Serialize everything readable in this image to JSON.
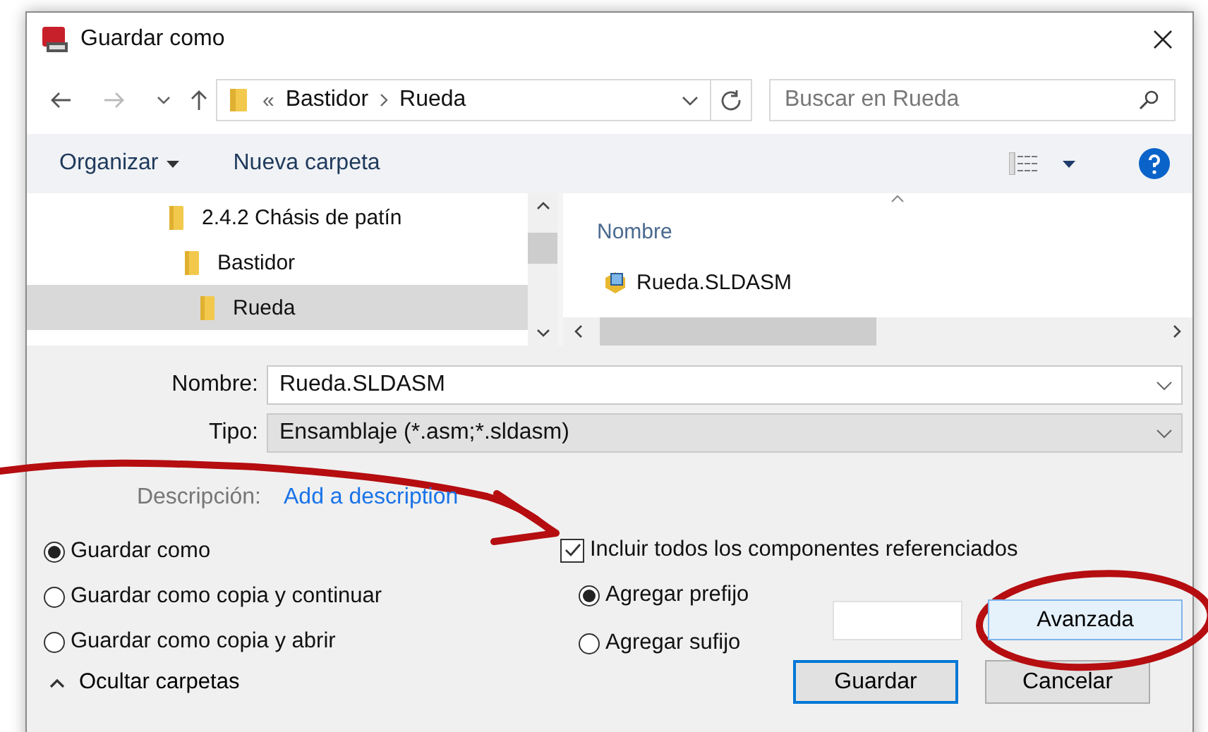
{
  "window": {
    "title": "Guardar como"
  },
  "nav": {
    "overflow": "«",
    "path": [
      {
        "label": "Bastidor"
      },
      {
        "label": "Rueda"
      }
    ],
    "search": {
      "placeholder": "Buscar en Rueda"
    }
  },
  "toolbar": {
    "organize": "Organizar",
    "new_folder": "Nueva carpeta"
  },
  "tree": [
    {
      "label": "2.4.2 Chásis de patín",
      "selected": false,
      "children": [
        {
          "label": "Bastidor",
          "selected": false,
          "children": [
            {
              "label": "Rueda",
              "selected": true
            }
          ]
        }
      ]
    }
  ],
  "files": {
    "column": "Nombre",
    "items": [
      {
        "name": "Rueda.SLDASM"
      }
    ]
  },
  "form": {
    "name_label": "Nombre:",
    "name_value": "Rueda.SLDASM",
    "type_label": "Tipo:",
    "type_value": "Ensamblaje (*.asm;*.sldasm)",
    "description_label": "Descripción:",
    "description_link": "Add a description"
  },
  "save_options": [
    {
      "label": "Guardar como",
      "selected": true
    },
    {
      "label": "Guardar como copia y continuar",
      "selected": false
    },
    {
      "label": "Guardar como copia y abrir",
      "selected": false
    }
  ],
  "include_refs": {
    "label": "Incluir todos los componentes referenciados",
    "checked": true
  },
  "affix_options": [
    {
      "label": "Agregar prefijo",
      "selected": true
    },
    {
      "label": "Agregar sufijo",
      "selected": false
    }
  ],
  "hide_folders": "Ocultar carpetas",
  "advanced_button": "Avanzada",
  "save_button": "Guardar",
  "cancel_button": "Cancelar"
}
